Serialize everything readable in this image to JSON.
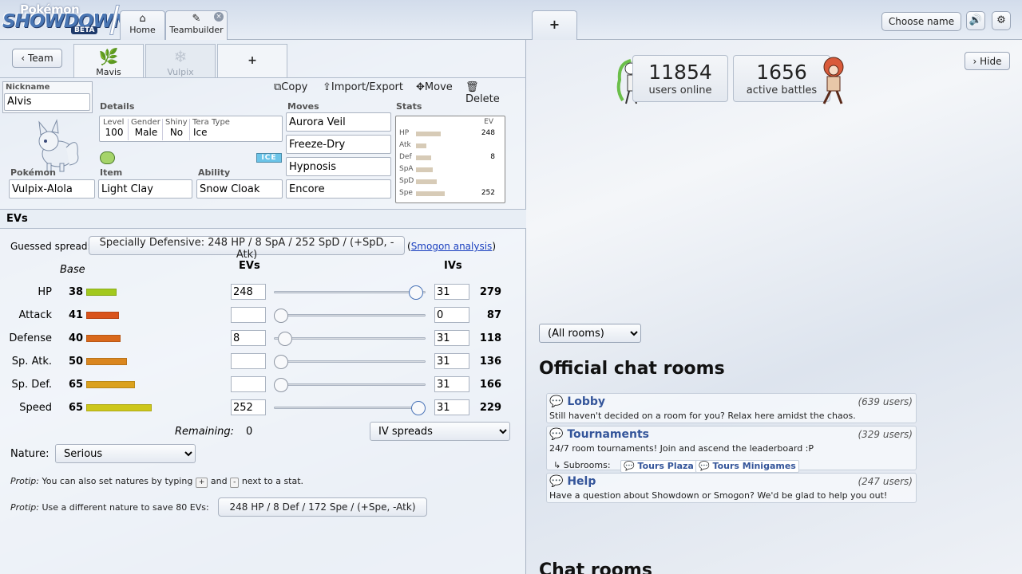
{
  "logo": {
    "line1": "Pokémon",
    "line2": "SHOWDOWN",
    "badge": "BETA"
  },
  "header": {
    "tabs": [
      {
        "label": "Home",
        "icon": "home-icon"
      },
      {
        "label": "Teambuilder",
        "icon": "edit-icon"
      }
    ],
    "add_tab": "+",
    "choose_name": "Choose name"
  },
  "team_bar": {
    "team_button": "Team",
    "tabs": [
      {
        "label": "Mavis"
      },
      {
        "label": "Vulpix"
      }
    ],
    "add": "+"
  },
  "set": {
    "nickname_label": "Nickname",
    "nickname": "Alvis",
    "details_label": "Details",
    "details": {
      "level_label": "Level",
      "level": "100",
      "gender_label": "Gender",
      "gender": "Male",
      "shiny_label": "Shiny",
      "shiny": "No",
      "tera_label": "Tera Type",
      "tera": "Ice"
    },
    "type_badge": "ICE",
    "pokemon_label": "Pokémon",
    "pokemon": "Vulpix-Alola",
    "item_label": "Item",
    "item": "Light Clay",
    "ability_label": "Ability",
    "ability": "Snow Cloak",
    "moves_label": "Moves",
    "moves": [
      "Aurora Veil",
      "Freeze-Dry",
      "Hypnosis",
      "Encore"
    ],
    "stats_label": "Stats",
    "ev_col": "EV",
    "mini_stats": [
      {
        "name": "HP",
        "ev": "248",
        "bar": 0.82
      },
      {
        "name": "Atk",
        "ev": "",
        "bar": 0.33
      },
      {
        "name": "Def",
        "ev": "8",
        "bar": 0.5
      },
      {
        "name": "SpA",
        "ev": "",
        "bar": 0.55
      },
      {
        "name": "SpD",
        "ev": "",
        "bar": 0.68
      },
      {
        "name": "Spe",
        "ev": "252",
        "bar": 0.95
      }
    ],
    "tools": {
      "copy": "Copy",
      "import": "Import/Export",
      "move": "Move",
      "delete": "Delete"
    }
  },
  "evs": {
    "heading": "EVs",
    "guessed_label": "Guessed spread:",
    "guessed_value": "Specially Defensive: 248 HP / 8 SpA / 252 SpD / (+SpD, -Atk)",
    "smogon_open": "(",
    "smogon_link": "Smogon analysis",
    "smogon_close": ")",
    "col_base": "Base",
    "col_evs": "EVs",
    "col_ivs": "IVs",
    "stats": [
      {
        "name": "HP",
        "base": "38",
        "ev": "248",
        "iv": "31",
        "total": "279",
        "slider": 0.98,
        "color": "#a2c91e",
        "base_frac": 0.15
      },
      {
        "name": "Attack",
        "base": "41",
        "ev": "",
        "iv": "0",
        "total": "87",
        "slider": 0.0,
        "color": "#d9531b",
        "base_frac": 0.16
      },
      {
        "name": "Defense",
        "base": "40",
        "ev": "8",
        "iv": "31",
        "total": "118",
        "slider": 0.03,
        "color": "#d9681b",
        "base_frac": 0.17
      },
      {
        "name": "Sp. Atk.",
        "base": "50",
        "ev": "",
        "iv": "31",
        "total": "136",
        "slider": 0.0,
        "color": "#da861f",
        "base_frac": 0.2
      },
      {
        "name": "Sp. Def.",
        "base": "65",
        "ev": "",
        "iv": "31",
        "total": "166",
        "slider": 0.0,
        "color": "#dba11e",
        "base_frac": 0.24
      },
      {
        "name": "Speed",
        "base": "65",
        "ev": "252",
        "iv": "31",
        "total": "229",
        "slider": 1.0,
        "color": "#cdc71b",
        "base_frac": 0.32
      }
    ],
    "remaining_label": "Remaining:",
    "remaining": "0",
    "iv_spreads": "IV spreads",
    "nature_label": "Nature:",
    "nature": "Serious",
    "protip1_label": "Protip:",
    "protip1_a": "You can also set natures by typing",
    "protip1_plus": "+",
    "protip1_and": "and",
    "protip1_minus": "-",
    "protip1_b": "next to a stat.",
    "protip2_label": "Protip:",
    "protip2_a": "Use a different nature to save 80 EVs:",
    "protip2_btn": "248 HP / 8 Def / 172 Spe / (+Spe, -Atk)"
  },
  "right": {
    "users_online": "11854",
    "users_online_label": "users online",
    "battles": "1656",
    "battles_label": "active battles",
    "hide": "Hide",
    "room_filter": "(All rooms)",
    "official_heading": "Official chat rooms",
    "rooms": [
      {
        "name": "Lobby",
        "users": "(639 users)",
        "desc": "Still haven't decided on a room for you? Relax here amidst the chaos."
      },
      {
        "name": "Tournaments",
        "users": "(329 users)",
        "desc": "24/7 room tournaments! Join and ascend the leaderboard :P",
        "subrooms_label": "Subrooms:",
        "subrooms": [
          "Tours Plaza",
          "Tours Minigames"
        ]
      },
      {
        "name": "Help",
        "users": "(247 users)",
        "desc": "Have a question about Showdown or Smogon? We'd be glad to help you out!"
      }
    ],
    "chat_heading": "Chat rooms"
  }
}
